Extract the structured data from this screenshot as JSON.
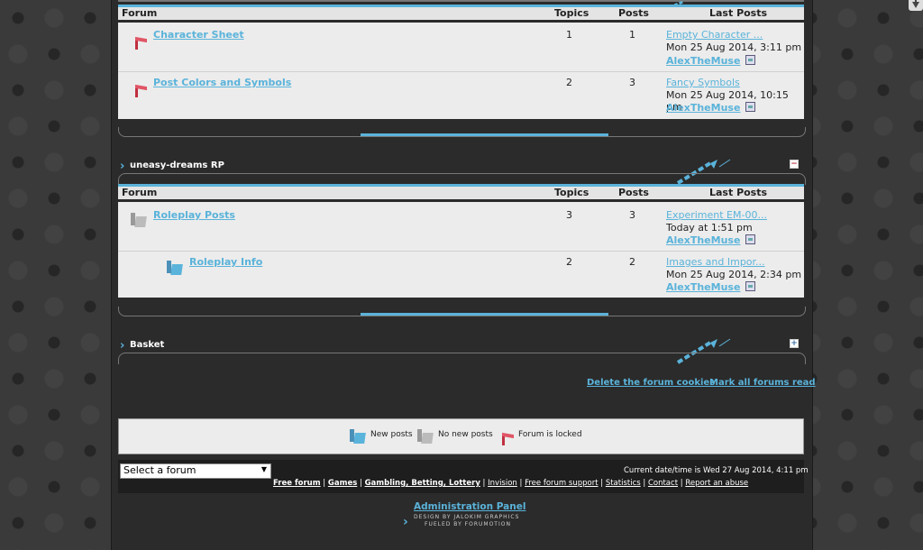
{
  "top_section": {
    "columns": {
      "forum": "Forum",
      "topics": "Topics",
      "posts": "Posts",
      "last_posts": "Last Posts"
    },
    "rows": [
      {
        "name": "Character Sheet",
        "topics": "1",
        "posts": "1",
        "last_title": "Empty Character ...",
        "last_date": "Mon 25 Aug 2014, 3:11 pm",
        "last_user": "AlexTheMuse",
        "icon": "forum-locked-icon"
      },
      {
        "name": "Post Colors and Symbols",
        "topics": "2",
        "posts": "3",
        "last_title": "Fancy Symbols",
        "last_date": "Mon 25 Aug 2014, 10:15 pm",
        "last_user": "AlexTheMuse",
        "icon": "forum-locked-icon"
      }
    ]
  },
  "category_rp": {
    "title": "uneasy-dreams RP",
    "toggle": "−",
    "columns": {
      "forum": "Forum",
      "topics": "Topics",
      "posts": "Posts",
      "last_posts": "Last Posts"
    },
    "rows": [
      {
        "name": "Roleplay Posts",
        "topics": "3",
        "posts": "3",
        "last_title": "Experiment EM-00...",
        "last_date": "Today at 1:51 pm",
        "last_user": "AlexTheMuse",
        "icon": "no-new-posts-icon"
      },
      {
        "name": "Roleplay Info",
        "topics": "2",
        "posts": "2",
        "last_title": "Images and Impor...",
        "last_date": "Mon 25 Aug 2014, 2:34 pm",
        "last_user": "AlexTheMuse",
        "icon": "new-posts-icon"
      }
    ]
  },
  "category_basket": {
    "title": "Basket",
    "toggle": "+"
  },
  "actions": {
    "delete_cookies": "Delete the forum cookies",
    "mark_read": "Mark all forums read"
  },
  "legend": {
    "new_posts": "New posts",
    "no_new_posts": "No new posts",
    "locked": "Forum is locked"
  },
  "footer": {
    "select_forum": "Select a forum",
    "datetime": "Current date/time is Wed 27 Aug 2014, 4:11 pm",
    "links": [
      "Free forum",
      "Games",
      "Gambling, Betting, Lottery",
      "Invision",
      "Free forum support",
      "Statistics",
      "Contact",
      "Report an abuse"
    ],
    "admin_panel": "Administration Panel",
    "credit1": "DESIGN BY JALOKIM GRAPHICS",
    "credit2": "FUELED BY FORUMOTION"
  },
  "colors": {
    "accent": "#5ab3da",
    "locked_red": "#e05565"
  }
}
